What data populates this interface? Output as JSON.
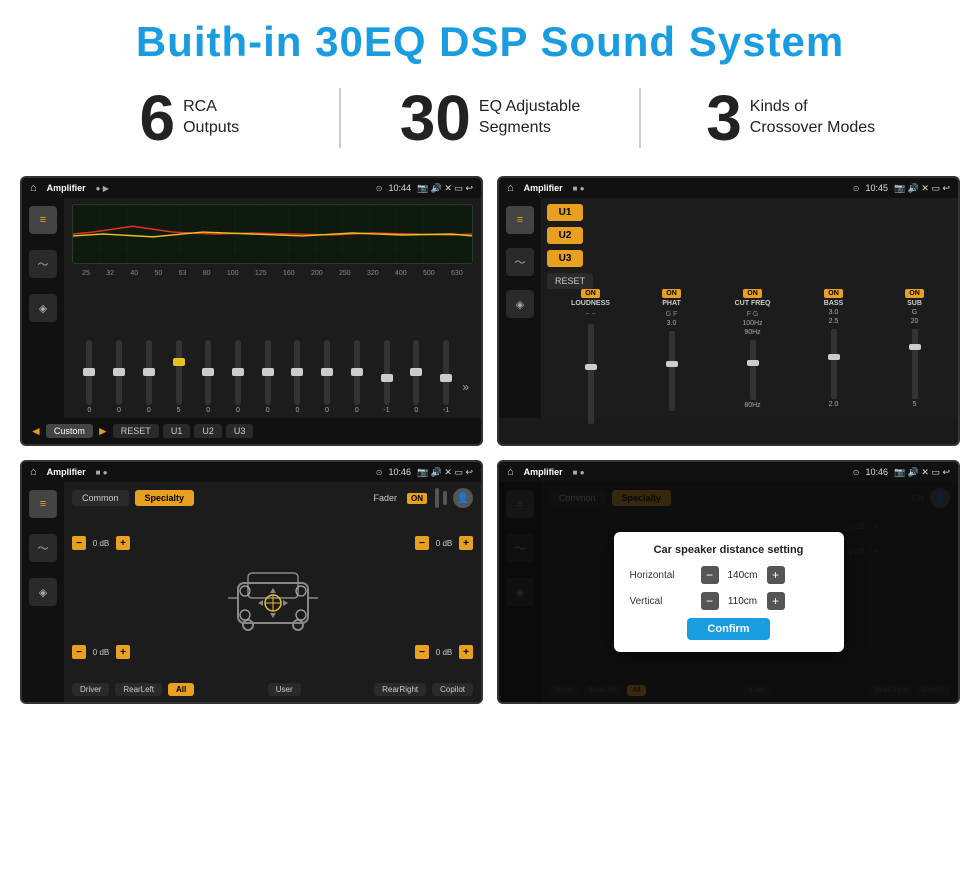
{
  "header": {
    "title": "Buith-in 30EQ DSP Sound System"
  },
  "stats": [
    {
      "number": "6",
      "label_line1": "RCA",
      "label_line2": "Outputs"
    },
    {
      "number": "30",
      "label_line1": "EQ Adjustable",
      "label_line2": "Segments"
    },
    {
      "number": "3",
      "label_line1": "Kinds of",
      "label_line2": "Crossover Modes"
    }
  ],
  "screens": {
    "eq": {
      "title": "Amplifier",
      "time": "10:44",
      "freq_labels": [
        "25",
        "32",
        "40",
        "50",
        "63",
        "80",
        "100",
        "125",
        "160",
        "200",
        "250",
        "320",
        "400",
        "500",
        "630"
      ],
      "slider_values": [
        "0",
        "0",
        "0",
        "5",
        "0",
        "0",
        "0",
        "0",
        "0",
        "0",
        "-1",
        "0",
        "-1"
      ],
      "buttons": [
        "Custom",
        "RESET",
        "U1",
        "U2",
        "U3"
      ]
    },
    "crossover": {
      "title": "Amplifier",
      "time": "10:45",
      "u_buttons": [
        "U1",
        "U2",
        "U3"
      ],
      "channels": [
        {
          "label": "LOUDNESS",
          "on": true
        },
        {
          "label": "PHAT",
          "on": true
        },
        {
          "label": "CUT FREQ",
          "on": true
        },
        {
          "label": "BASS",
          "on": true
        },
        {
          "label": "SUB",
          "on": true
        }
      ],
      "reset_label": "RESET"
    },
    "fader": {
      "title": "Amplifier",
      "time": "10:46",
      "tabs": [
        "Common",
        "Specialty"
      ],
      "active_tab": "Specialty",
      "fader_label": "Fader",
      "fader_on": "ON",
      "db_values": {
        "top_left": "0 dB",
        "top_right": "0 dB",
        "bot_left": "0 dB",
        "bot_right": "0 dB"
      },
      "bottom_buttons": [
        "Driver",
        "RearLeft",
        "All",
        "User",
        "RearRight",
        "Copilot"
      ]
    },
    "dialog": {
      "title": "Amplifier",
      "time": "10:46",
      "tabs": [
        "Common",
        "Specialty"
      ],
      "dialog": {
        "title": "Car speaker distance setting",
        "horizontal_label": "Horizontal",
        "horizontal_value": "140cm",
        "vertical_label": "Vertical",
        "vertical_value": "110cm",
        "confirm_label": "Confirm",
        "db_values": {
          "top_right": "0 dB",
          "bot_right": "0 dB"
        },
        "bottom_buttons": [
          "Driver",
          "RearLeft",
          "All",
          "User",
          "RearRight",
          "Copilot"
        ]
      }
    }
  }
}
